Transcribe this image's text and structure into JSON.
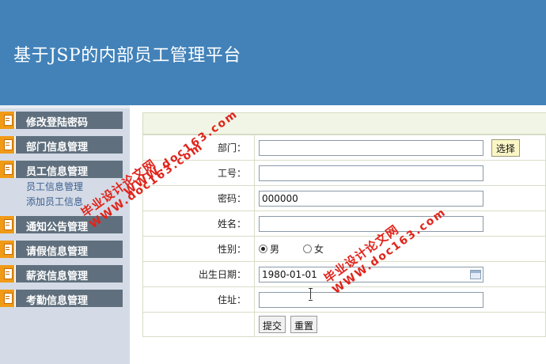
{
  "header": {
    "title": "基于JSP的内部员工管理平台"
  },
  "sidebar": {
    "items": [
      {
        "label": "修改登陆密码"
      },
      {
        "label": "部门信息管理"
      },
      {
        "label": "员工信息管理"
      },
      {
        "label": "通知公告管理"
      },
      {
        "label": "请假信息管理"
      },
      {
        "label": "薪资信息管理"
      },
      {
        "label": "考勤信息管理"
      }
    ],
    "sub_items": [
      {
        "label": "员工信息管理"
      },
      {
        "label": "添加员工信息"
      }
    ]
  },
  "form": {
    "department_label": "部门：",
    "department_value": "",
    "choose_label": "选择",
    "employee_no_label": "工号：",
    "employee_no_value": "",
    "password_label": "密码：",
    "password_value": "000000",
    "name_label": "姓名：",
    "name_value": "",
    "gender_label": "性别：",
    "gender_male": "男",
    "gender_female": "女",
    "gender_selected": "男",
    "birthdate_label": "出生日期：",
    "birthdate_value": "1980-01-01",
    "address_label": "住址：",
    "address_value": "",
    "submit_label": "提交",
    "reset_label": "重置"
  },
  "watermark": {
    "cn": "毕业设计论文网",
    "url": "WWW.doc163.com"
  }
}
